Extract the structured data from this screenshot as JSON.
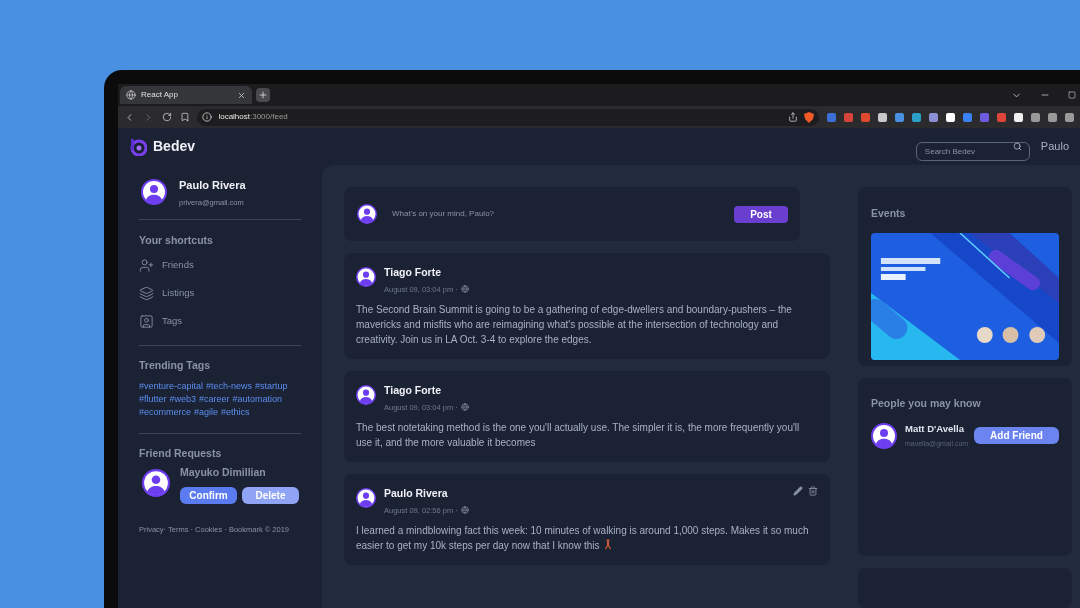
{
  "browser": {
    "tab": {
      "title": "React App"
    },
    "url": {
      "host": "localhost",
      "path": ":3000/feed"
    }
  },
  "header": {
    "brand": "Bedev",
    "search": {
      "placeholder": "Search Bedev"
    },
    "user": "Paulo"
  },
  "sidebar": {
    "profile": {
      "name": "Paulo Rivera",
      "email": "privera@gmail.com"
    },
    "shortcuts": {
      "title": "Your shortcuts",
      "items": [
        {
          "label": "Friends"
        },
        {
          "label": "Listings"
        },
        {
          "label": "Tags"
        }
      ]
    },
    "trending": {
      "title": "Trending Tags",
      "tags": [
        "#venture-capital",
        "#tech-news",
        "#startup",
        "#flutter",
        "#web3",
        "#career",
        "#automation",
        "#ecommerce",
        "#agile",
        "#ethics"
      ]
    },
    "friend_requests": {
      "title": "Friend Requests",
      "name": "Mayuko Dimillian",
      "buttons": [
        "Confirm",
        "Delete"
      ]
    },
    "footer": "Privacy· Terms · Cookies · Bookmark © 2019"
  },
  "composer": {
    "placeholder": "What's on your mind, Paulo?",
    "button": "Post"
  },
  "posts": [
    {
      "author": "Tiago Forte",
      "time": "August 09, 03:04 pm ·",
      "text": "The Second Brain Summit is going to be a gathering of edge-dwellers and boundary-pushers – the mavericks and misfits who are reimagining what's possible at the intersection of technology and creativity. Join us in LA Oct. 3-4 to explore the edges.",
      "own": false
    },
    {
      "author": "Tiago Forte",
      "time": "August 09, 03:04 pm ·",
      "text": "The best notetaking method is the one you'll actually use. The simpler it is, the more frequently you'll use it, and the more valuable it becomes",
      "own": false
    },
    {
      "author": "Paulo Rivera",
      "time": "August 09, 02:56 pm ·",
      "text": "I learned a mindblowing fact this week: 10 minutes of walking is around 1,000 steps. Makes it so much easier to get my 10k steps per day now that I know this",
      "own": true
    }
  ],
  "events": {
    "title": "Events"
  },
  "people": {
    "title": "People you may know",
    "person": {
      "name": "Matt D'Avella",
      "email": "mavella@gmail.com"
    },
    "button": "Add Friend"
  }
}
